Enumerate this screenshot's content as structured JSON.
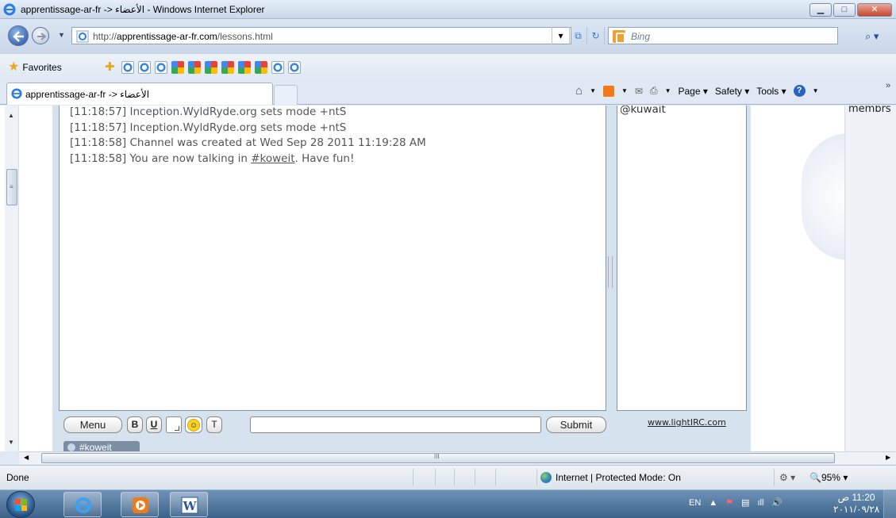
{
  "window": {
    "title": "apprentissage-ar-fr -> الأعضاء - Windows Internet Explorer",
    "controls": {
      "minimize": "▁",
      "maximize": "□",
      "close": "✕"
    }
  },
  "addressbar": {
    "url_prefix": "http://",
    "url_host": "apprentissage-ar-fr.com",
    "url_path": "/lessons.html",
    "search_placeholder": "Bing"
  },
  "favorites": {
    "label": "Favorites",
    "icons": [
      "add-favorite-icon",
      "ie-page-icon",
      "ie-page-icon",
      "ie-page-icon",
      "google-icon",
      "google-icon",
      "google-icon",
      "google-icon",
      "google-icon",
      "google-icon",
      "ie-page-icon",
      "ie-page-icon"
    ]
  },
  "tabs": [
    {
      "title": "apprentissage-ar-fr -> الأعضاء"
    }
  ],
  "commandbar": {
    "page": "Page ▾",
    "safety": "Safety ▾",
    "tools": "Tools ▾",
    "help": "?"
  },
  "chat": {
    "messages": [
      "[11:18:57] Inception.WyldRyde.org sets mode +ntS",
      "[11:18:57] Inception.WyldRyde.org sets mode +ntS",
      "[11:18:58] Channel was created at Wed Sep 28 2011 11:19:28 AM"
    ],
    "last_message_prefix": "[11:18:58] You are now talking in ",
    "last_message_channel": "#koweit",
    "last_message_suffix": ". Have fun!",
    "users": [
      "@kuwait"
    ],
    "buttons": {
      "menu": "Menu",
      "bold": "B",
      "underline": "U",
      "text": "T",
      "submit": "Submit"
    },
    "input_value": "",
    "credit": "www.lightIRC.com",
    "channel_tab": "#koweit"
  },
  "sidebar_label": "membrs",
  "scroll": {
    "hscroll_grip": "III",
    "vscroll_grip": "≡"
  },
  "status": {
    "left": "Done",
    "zone": "Internet | Protected Mode: On",
    "zoom": "95%"
  },
  "taskbar": {
    "tray_lang": "EN",
    "clock_time": "11:20 ص",
    "clock_date": "٢٠١١/٠٩/٢٨"
  }
}
